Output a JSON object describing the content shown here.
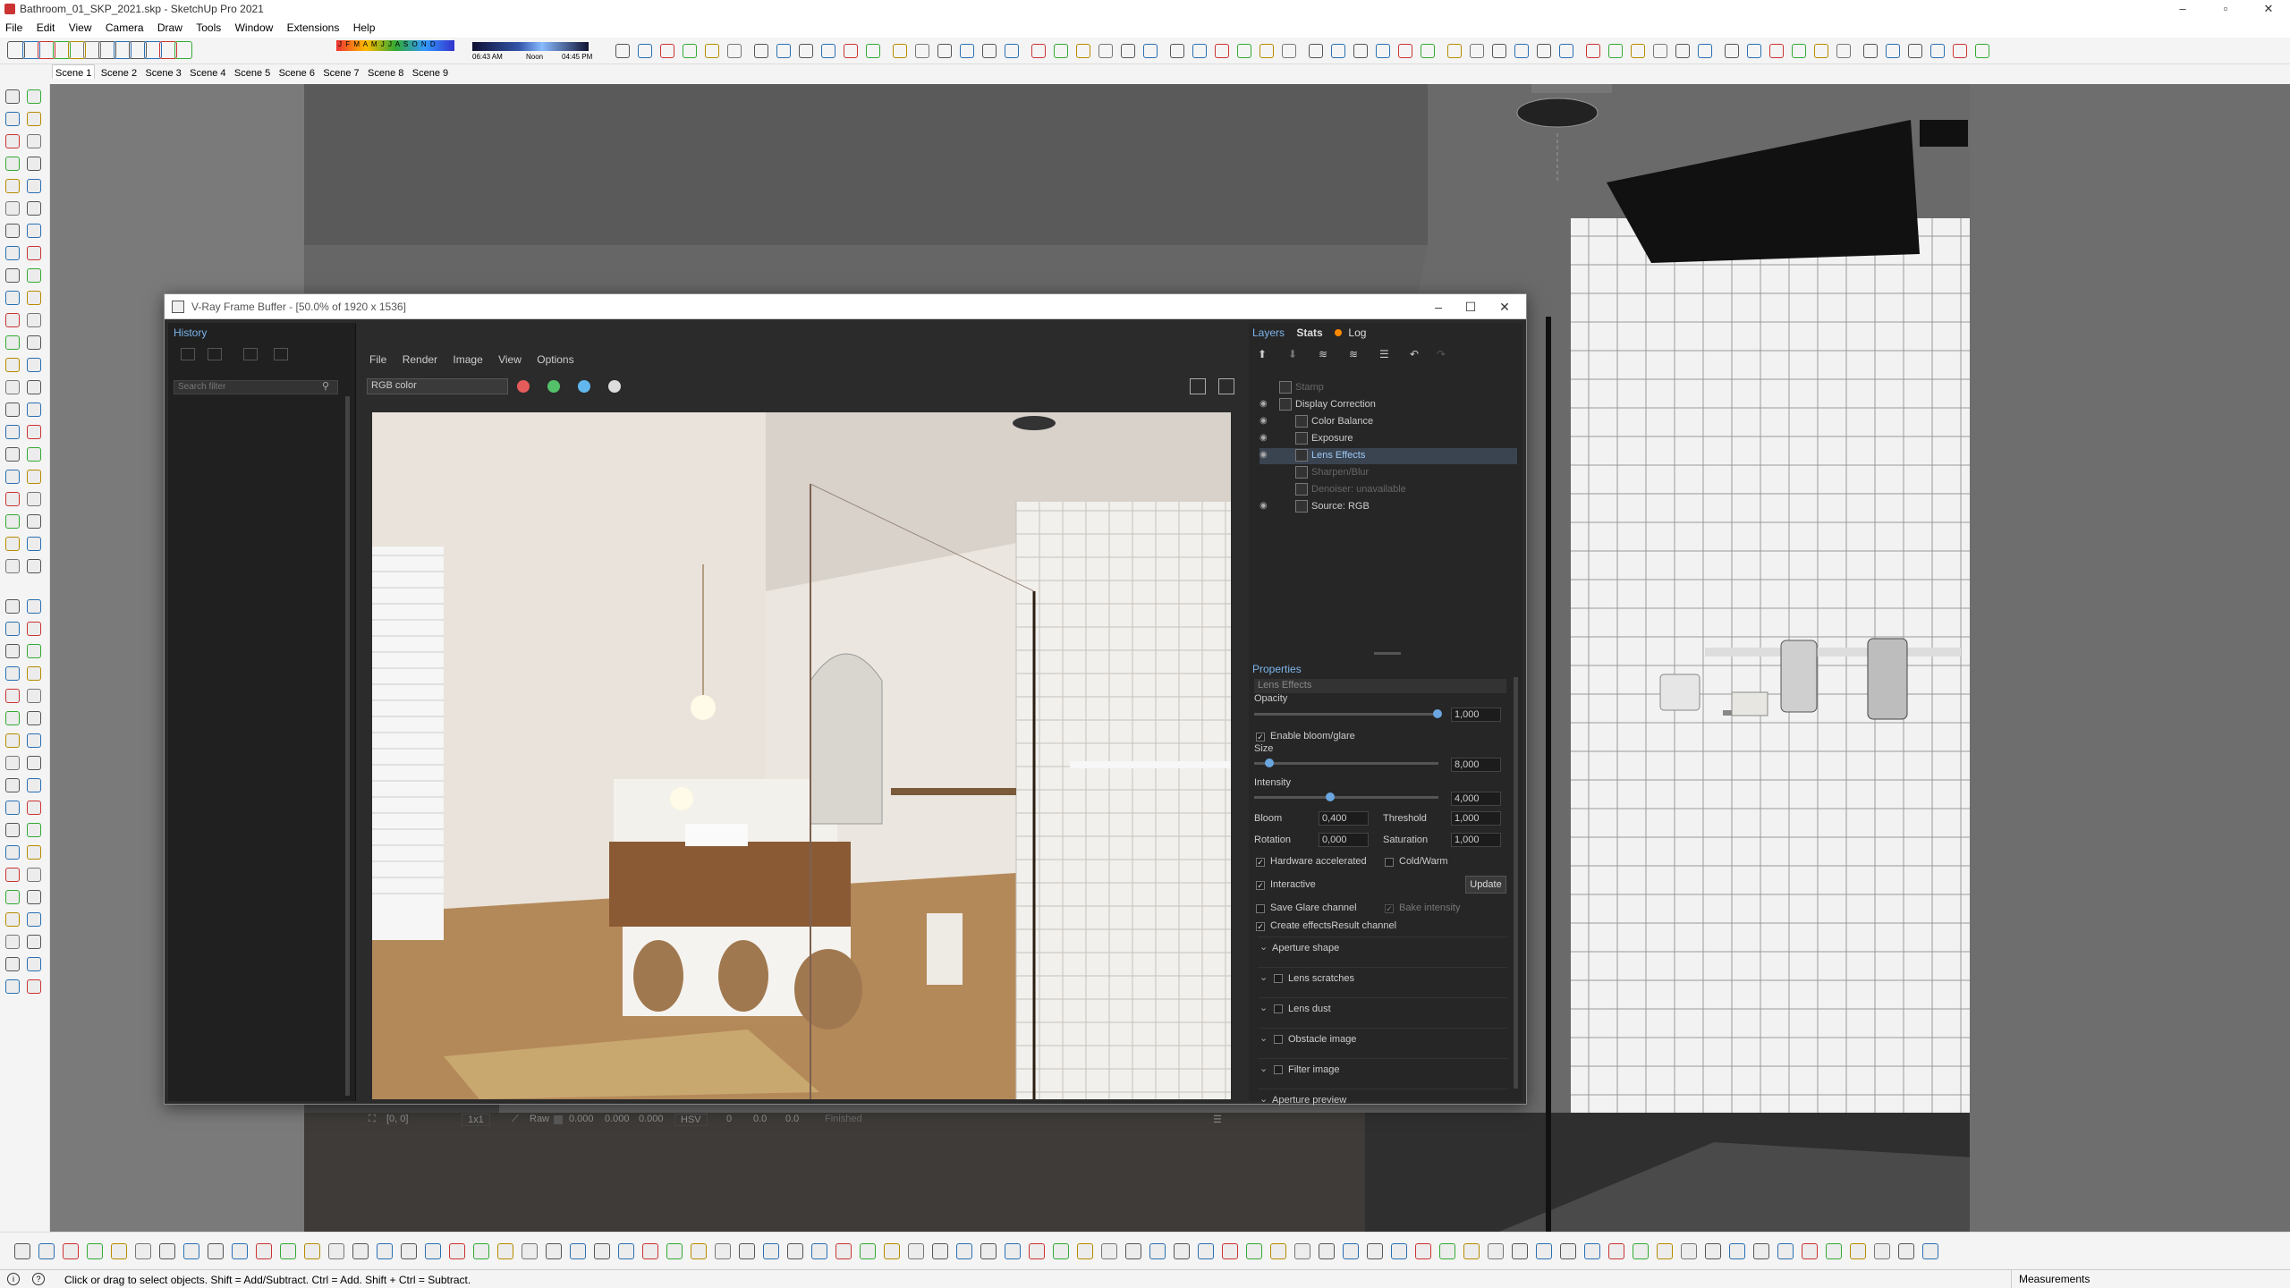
{
  "app": {
    "title": "Bathroom_01_SKP_2021.skp - SketchUp Pro 2021",
    "menu": [
      "File",
      "Edit",
      "View",
      "Camera",
      "Draw",
      "Tools",
      "Window",
      "Extensions",
      "Help"
    ],
    "shadow": {
      "months": "J F M A M J J A S O N D",
      "time_start": "06:43 AM",
      "time_mid": "Noon",
      "time_end": "04:45 PM"
    },
    "scenes": [
      "Scene 1",
      "Scene 2",
      "Scene 3",
      "Scene 4",
      "Scene 5",
      "Scene 6",
      "Scene 7",
      "Scene 8",
      "Scene 9"
    ],
    "status_message": "Click or drag to select objects. Shift = Add/Subtract. Ctrl = Add. Shift + Ctrl = Subtract.",
    "measurements_label": "Measurements"
  },
  "vfb": {
    "title": "V-Ray Frame Buffer - [50.0% of 1920 x 1536]",
    "history_label": "History",
    "search_placeholder": "Search filter",
    "menu": [
      "File",
      "Render",
      "Image",
      "View",
      "Options"
    ],
    "channel": "RGB color",
    "status": {
      "coords": "[0, 0]",
      "zoom": "1x1",
      "raw": "Raw",
      "r": "0.000",
      "g": "0.000",
      "b": "0.000",
      "mode": "HSV",
      "h": "0",
      "s": "0.0",
      "v": "0.0",
      "state": "Finished"
    },
    "tabs": {
      "layers": "Layers",
      "stats": "Stats",
      "log": "Log"
    },
    "layers": [
      {
        "label": "Stamp",
        "indent": 1,
        "visible": false,
        "dim": true
      },
      {
        "label": "Display Correction",
        "indent": 1,
        "visible": true,
        "dim": false
      },
      {
        "label": "Color Balance",
        "indent": 2,
        "visible": true,
        "dim": false
      },
      {
        "label": "Exposure",
        "indent": 2,
        "visible": true,
        "dim": false
      },
      {
        "label": "Lens Effects",
        "indent": 2,
        "visible": true,
        "dim": false,
        "selected": true
      },
      {
        "label": "Sharpen/Blur",
        "indent": 2,
        "visible": false,
        "dim": true
      },
      {
        "label": "Denoiser: unavailable",
        "indent": 2,
        "visible": false,
        "dim": true
      },
      {
        "label": "Source: RGB",
        "indent": 2,
        "visible": true,
        "dim": false
      }
    ],
    "properties": {
      "header": "Properties",
      "section": "Lens Effects",
      "opacity_label": "Opacity",
      "opacity": "1,000",
      "enable_bloom": "Enable bloom/glare",
      "size_label": "Size",
      "size": "8,000",
      "intensity_label": "Intensity",
      "intensity": "4,000",
      "bloom_label": "Bloom",
      "bloom": "0,400",
      "threshold_label": "Threshold",
      "threshold": "1,000",
      "rotation_label": "Rotation",
      "rotation": "0,000",
      "saturation_label": "Saturation",
      "saturation": "1,000",
      "hw_accel": "Hardware accelerated",
      "cold_warm": "Cold/Warm",
      "interactive": "Interactive",
      "update": "Update",
      "save_glare": "Save Glare channel",
      "bake_intensity": "Bake intensity",
      "create_effects": "Create effectsResult channel",
      "sections": [
        "Aperture shape",
        "Lens scratches",
        "Lens dust",
        "Obstacle image",
        "Filter image",
        "Aperture preview"
      ]
    }
  }
}
